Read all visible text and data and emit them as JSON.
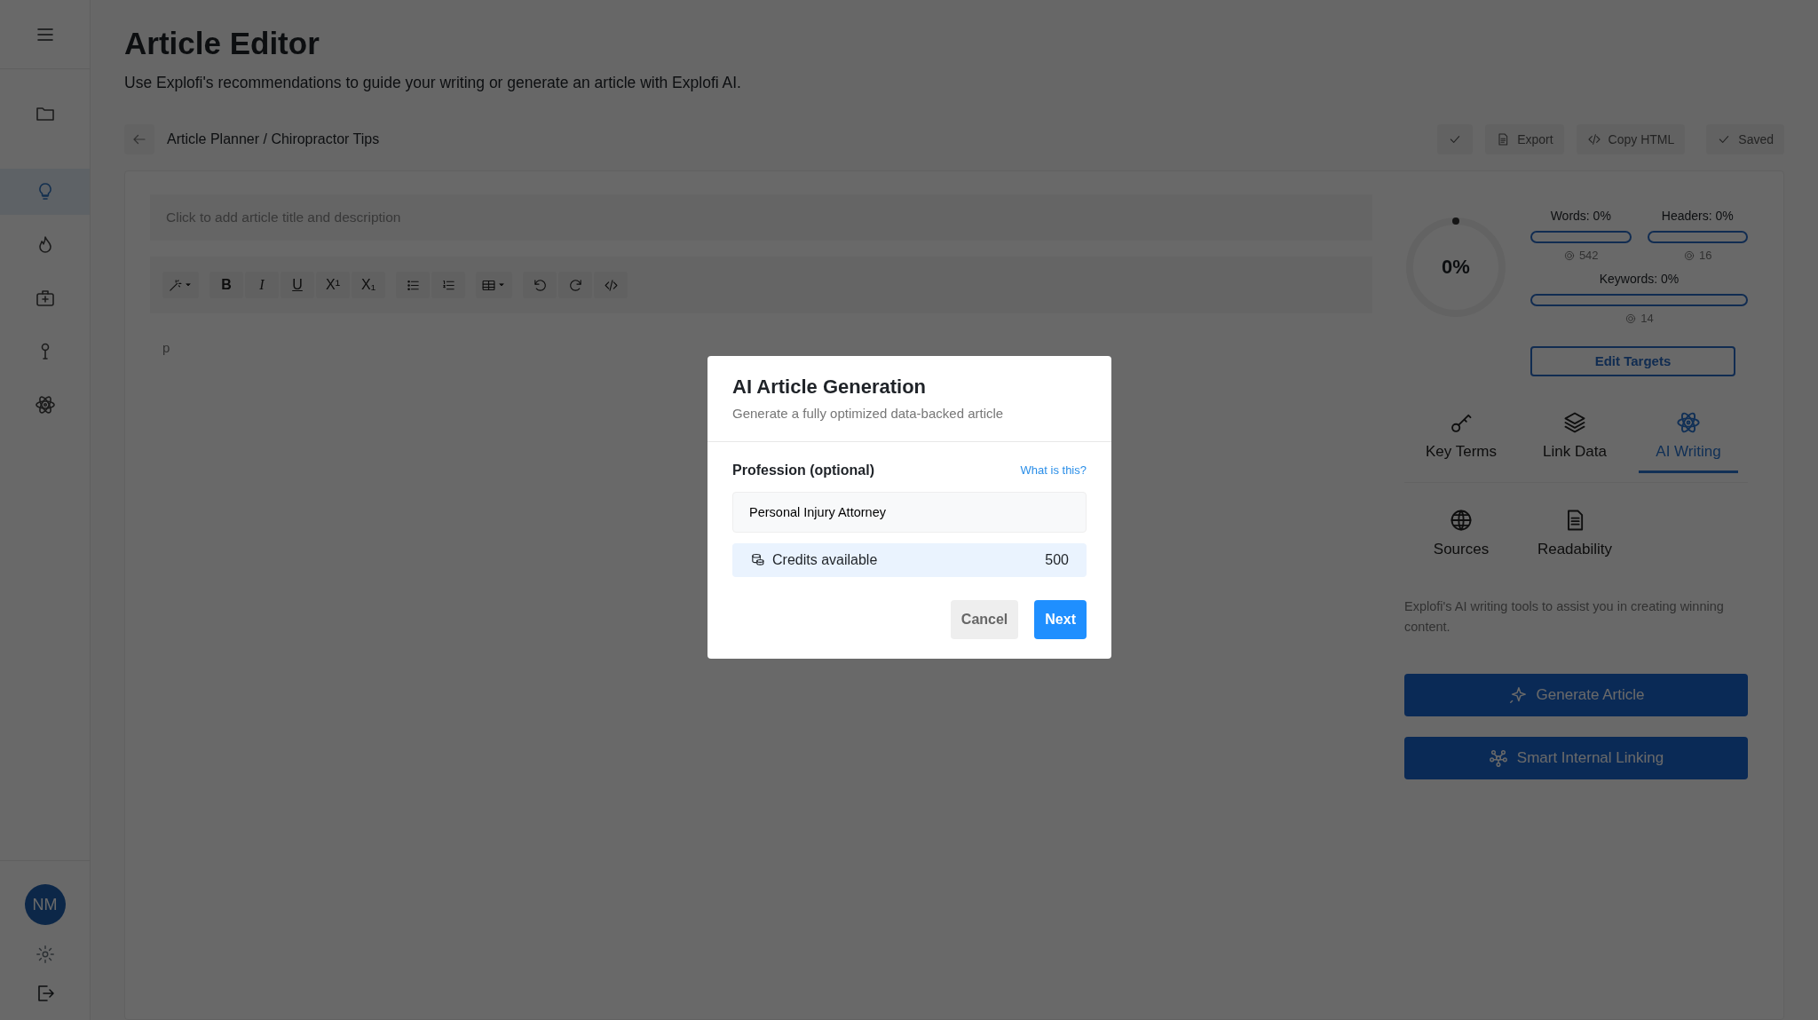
{
  "sidebar": {
    "items": [
      {
        "selected": false
      },
      {
        "selected": true
      },
      {
        "selected": false
      },
      {
        "selected": false
      },
      {
        "selected": false
      },
      {
        "selected": false
      }
    ],
    "avatar": "NM"
  },
  "page": {
    "title": "Article Editor",
    "subtitle": "Use Explofi's recommendations to guide your writing or generate an article with Explofi AI."
  },
  "breadcrumb": "Article Planner / Chiropractor Tips",
  "actions": [
    {
      "kind": "check"
    },
    {
      "kind": "export",
      "label": "Export"
    },
    {
      "kind": "code",
      "label": "Copy HTML"
    },
    {
      "kind": "saved",
      "label": "Saved"
    }
  ],
  "editor": {
    "title_placeholder": "Click to add article title and description",
    "body": "p",
    "toolbar": [
      [
        {
          "kind": "wand"
        }
      ],
      [
        {
          "kind": "bold",
          "glyph": "B"
        },
        {
          "kind": "italic",
          "glyph": "I"
        },
        {
          "kind": "underline",
          "glyph": "U"
        },
        {
          "kind": "sup",
          "glyph": "X¹"
        },
        {
          "kind": "sub",
          "glyph": "X₁"
        }
      ],
      [
        {
          "kind": "ul"
        },
        {
          "kind": "ol"
        }
      ],
      [
        {
          "kind": "table"
        }
      ],
      [
        {
          "kind": "undo"
        },
        {
          "kind": "redo"
        },
        {
          "kind": "code"
        }
      ]
    ]
  },
  "score": {
    "value": "0%",
    "level": 0
  },
  "metrics": [
    {
      "label": "Words: 0%",
      "level": 0,
      "target": "542"
    },
    {
      "label": "Headers: 0%",
      "level": 0,
      "target": "16"
    },
    {
      "label": "Keywords: 0%",
      "level": 0,
      "target": "14"
    }
  ],
  "edit_targets": "Edit Targets",
  "tabs": [
    {
      "label": "Key Terms",
      "selected": false
    },
    {
      "label": "Link Data",
      "selected": false
    },
    {
      "label": "AI Writing",
      "selected": true
    },
    {
      "label": "Sources",
      "selected": false
    },
    {
      "label": "Readability",
      "selected": false
    }
  ],
  "panel": {
    "description": "Explofi's AI writing tools to assist you in creating winning content.",
    "buttons": [
      {
        "kind": "sparkle",
        "label": "Generate Article"
      },
      {
        "kind": "network",
        "label": "Smart Internal Linking"
      }
    ]
  },
  "modal": {
    "title": "AI Article Generation",
    "subtitle": "Generate a fully optimized data-backed article",
    "field_label": "Profession (optional)",
    "help_link": "What is this?",
    "field_value": "Personal Injury Attorney",
    "credits_label": "Credits available",
    "credits_value": "500",
    "buttons": [
      {
        "kind": "secondary",
        "label": "Cancel"
      },
      {
        "kind": "primary",
        "label": "Next"
      }
    ]
  }
}
